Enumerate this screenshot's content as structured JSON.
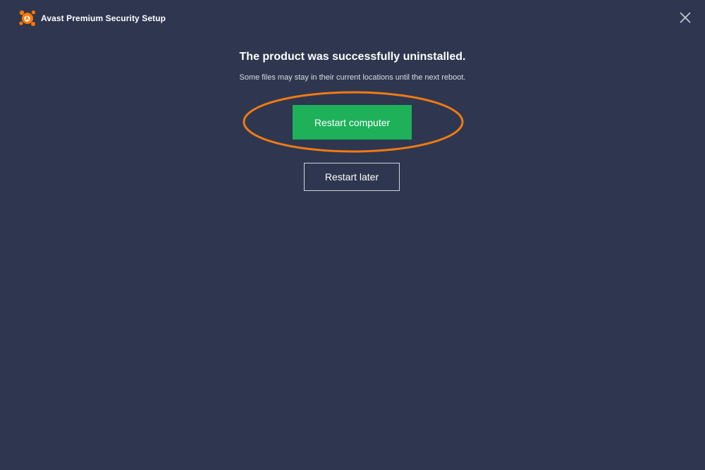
{
  "window": {
    "title": "Avast Premium Security Setup",
    "icons": {
      "logo": "avast-logo-icon",
      "close": "close-icon"
    }
  },
  "main": {
    "headline": "The product was successfully uninstalled.",
    "subtext": "Some files may stay in their current locations until the next reboot.",
    "restart_now_label": "Restart computer",
    "restart_later_label": "Restart later"
  },
  "colors": {
    "background": "#2e374f",
    "primary_button": "#1eb15a",
    "highlight": "#f07a14",
    "brand": "#ff7800"
  }
}
